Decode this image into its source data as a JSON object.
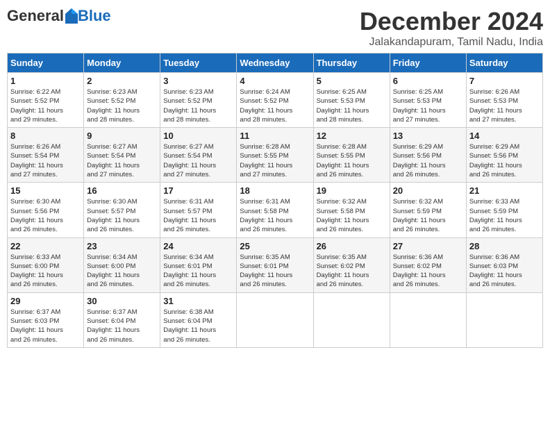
{
  "logo": {
    "general": "General",
    "blue": "Blue"
  },
  "title": "December 2024",
  "location": "Jalakandapuram, Tamil Nadu, India",
  "days_of_week": [
    "Sunday",
    "Monday",
    "Tuesday",
    "Wednesday",
    "Thursday",
    "Friday",
    "Saturday"
  ],
  "weeks": [
    [
      {
        "day": "1",
        "info": "Sunrise: 6:22 AM\nSunset: 5:52 PM\nDaylight: 11 hours\nand 29 minutes."
      },
      {
        "day": "2",
        "info": "Sunrise: 6:23 AM\nSunset: 5:52 PM\nDaylight: 11 hours\nand 28 minutes."
      },
      {
        "day": "3",
        "info": "Sunrise: 6:23 AM\nSunset: 5:52 PM\nDaylight: 11 hours\nand 28 minutes."
      },
      {
        "day": "4",
        "info": "Sunrise: 6:24 AM\nSunset: 5:52 PM\nDaylight: 11 hours\nand 28 minutes."
      },
      {
        "day": "5",
        "info": "Sunrise: 6:25 AM\nSunset: 5:53 PM\nDaylight: 11 hours\nand 28 minutes."
      },
      {
        "day": "6",
        "info": "Sunrise: 6:25 AM\nSunset: 5:53 PM\nDaylight: 11 hours\nand 27 minutes."
      },
      {
        "day": "7",
        "info": "Sunrise: 6:26 AM\nSunset: 5:53 PM\nDaylight: 11 hours\nand 27 minutes."
      }
    ],
    [
      {
        "day": "8",
        "info": "Sunrise: 6:26 AM\nSunset: 5:54 PM\nDaylight: 11 hours\nand 27 minutes."
      },
      {
        "day": "9",
        "info": "Sunrise: 6:27 AM\nSunset: 5:54 PM\nDaylight: 11 hours\nand 27 minutes."
      },
      {
        "day": "10",
        "info": "Sunrise: 6:27 AM\nSunset: 5:54 PM\nDaylight: 11 hours\nand 27 minutes."
      },
      {
        "day": "11",
        "info": "Sunrise: 6:28 AM\nSunset: 5:55 PM\nDaylight: 11 hours\nand 27 minutes."
      },
      {
        "day": "12",
        "info": "Sunrise: 6:28 AM\nSunset: 5:55 PM\nDaylight: 11 hours\nand 26 minutes."
      },
      {
        "day": "13",
        "info": "Sunrise: 6:29 AM\nSunset: 5:56 PM\nDaylight: 11 hours\nand 26 minutes."
      },
      {
        "day": "14",
        "info": "Sunrise: 6:29 AM\nSunset: 5:56 PM\nDaylight: 11 hours\nand 26 minutes."
      }
    ],
    [
      {
        "day": "15",
        "info": "Sunrise: 6:30 AM\nSunset: 5:56 PM\nDaylight: 11 hours\nand 26 minutes."
      },
      {
        "day": "16",
        "info": "Sunrise: 6:30 AM\nSunset: 5:57 PM\nDaylight: 11 hours\nand 26 minutes."
      },
      {
        "day": "17",
        "info": "Sunrise: 6:31 AM\nSunset: 5:57 PM\nDaylight: 11 hours\nand 26 minutes."
      },
      {
        "day": "18",
        "info": "Sunrise: 6:31 AM\nSunset: 5:58 PM\nDaylight: 11 hours\nand 26 minutes."
      },
      {
        "day": "19",
        "info": "Sunrise: 6:32 AM\nSunset: 5:58 PM\nDaylight: 11 hours\nand 26 minutes."
      },
      {
        "day": "20",
        "info": "Sunrise: 6:32 AM\nSunset: 5:59 PM\nDaylight: 11 hours\nand 26 minutes."
      },
      {
        "day": "21",
        "info": "Sunrise: 6:33 AM\nSunset: 5:59 PM\nDaylight: 11 hours\nand 26 minutes."
      }
    ],
    [
      {
        "day": "22",
        "info": "Sunrise: 6:33 AM\nSunset: 6:00 PM\nDaylight: 11 hours\nand 26 minutes."
      },
      {
        "day": "23",
        "info": "Sunrise: 6:34 AM\nSunset: 6:00 PM\nDaylight: 11 hours\nand 26 minutes."
      },
      {
        "day": "24",
        "info": "Sunrise: 6:34 AM\nSunset: 6:01 PM\nDaylight: 11 hours\nand 26 minutes."
      },
      {
        "day": "25",
        "info": "Sunrise: 6:35 AM\nSunset: 6:01 PM\nDaylight: 11 hours\nand 26 minutes."
      },
      {
        "day": "26",
        "info": "Sunrise: 6:35 AM\nSunset: 6:02 PM\nDaylight: 11 hours\nand 26 minutes."
      },
      {
        "day": "27",
        "info": "Sunrise: 6:36 AM\nSunset: 6:02 PM\nDaylight: 11 hours\nand 26 minutes."
      },
      {
        "day": "28",
        "info": "Sunrise: 6:36 AM\nSunset: 6:03 PM\nDaylight: 11 hours\nand 26 minutes."
      }
    ],
    [
      {
        "day": "29",
        "info": "Sunrise: 6:37 AM\nSunset: 6:03 PM\nDaylight: 11 hours\nand 26 minutes."
      },
      {
        "day": "30",
        "info": "Sunrise: 6:37 AM\nSunset: 6:04 PM\nDaylight: 11 hours\nand 26 minutes."
      },
      {
        "day": "31",
        "info": "Sunrise: 6:38 AM\nSunset: 6:04 PM\nDaylight: 11 hours\nand 26 minutes."
      },
      {
        "day": "",
        "info": ""
      },
      {
        "day": "",
        "info": ""
      },
      {
        "day": "",
        "info": ""
      },
      {
        "day": "",
        "info": ""
      }
    ]
  ]
}
